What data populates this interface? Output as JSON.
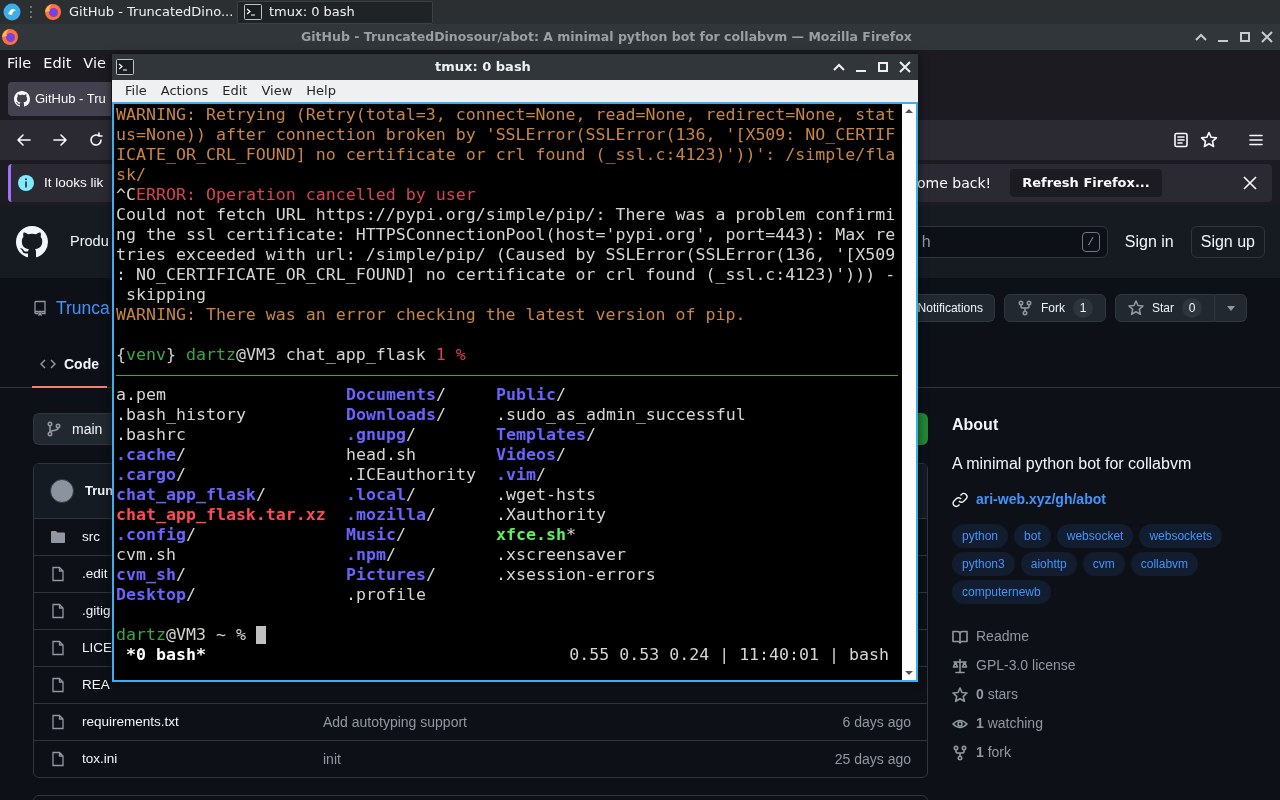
{
  "taskbar": {
    "tasks": [
      {
        "label": "GitHub - TruncatedDino...",
        "kind": "browser",
        "selected": false
      },
      {
        "label": "tmux: 0 bash",
        "kind": "terminal",
        "selected": true
      }
    ]
  },
  "browser": {
    "title": "GitHub - TruncatedDinosour/abot: A minimal python bot for collabvm — Mozilla Firefox",
    "menu": [
      "File",
      "Edit",
      "Vie"
    ],
    "tab": "GitHub - Tru",
    "notification": {
      "text_start": "It looks lik",
      "text_end": "ome back!",
      "button": "Refresh Firefox..."
    },
    "page": {
      "header": {
        "nav": "Produ",
        "search_placeholder": "h",
        "search_key": "/",
        "sign_in": "Sign in",
        "sign_up": "Sign up"
      },
      "repo": {
        "name": "Trunca",
        "actions": [
          {
            "kind": "notifications",
            "label": "Notifications"
          },
          {
            "kind": "fork",
            "label": "Fork",
            "count": "1"
          },
          {
            "kind": "star",
            "label": "Star",
            "count": "0"
          }
        ]
      },
      "tabs": [
        {
          "label": "Code",
          "selected": true
        }
      ],
      "branch": "main",
      "commit_author": "Trun",
      "files": [
        {
          "kind": "folder",
          "name": "src"
        },
        {
          "kind": "file",
          "name": ".edit"
        },
        {
          "kind": "file",
          "name": ".gitig"
        },
        {
          "kind": "file",
          "name": "LICE"
        },
        {
          "kind": "file",
          "name": "REA"
        },
        {
          "kind": "file",
          "name": "requirements.txt",
          "message": "Add autotyping support",
          "age": "6 days ago"
        },
        {
          "kind": "file",
          "name": "tox.ini",
          "message": "init",
          "age": "25 days ago"
        }
      ],
      "about": {
        "title": "About",
        "description": "A minimal python bot for collabvm",
        "link": "ari-web.xyz/gh/abot",
        "topics": [
          "python",
          "bot",
          "websocket",
          "websockets",
          "python3",
          "aiohttp",
          "cvm",
          "collabvm",
          "computernewb"
        ],
        "stats": [
          {
            "kind": "readme",
            "text": "Readme"
          },
          {
            "kind": "license",
            "text": "GPL-3.0 license"
          },
          {
            "kind": "stars",
            "text": "**0** stars"
          },
          {
            "kind": "watching",
            "text": "**1** watching"
          },
          {
            "kind": "forks",
            "text": "**1** fork"
          }
        ]
      }
    }
  },
  "terminal": {
    "title": "tmux: 0 bash",
    "menu": [
      "File",
      "Actions",
      "Edit",
      "View",
      "Help"
    ],
    "lines": [
      [
        {
          "kind": "warning",
          "text": "WARNING: Retrying (Retry(total=3, connect=None, read=None, redirect=None, stat"
        }
      ],
      [
        {
          "kind": "warning",
          "text": "us=None)) after connection broken by 'SSLError(SSLError(136, '[X509: NO_CERTIF"
        }
      ],
      [
        {
          "kind": "warning",
          "text": "ICATE_OR_CRL_FOUND] no certificate or crl found (_ssl.c:4123)'))': /simple/fla"
        }
      ],
      [
        {
          "kind": "warning",
          "text": "sk/"
        }
      ],
      [
        {
          "kind": "plain",
          "text": "^C"
        },
        {
          "kind": "error",
          "text": "ERROR: Operation cancelled by user"
        }
      ],
      [
        {
          "kind": "plain",
          "text": "Could not fetch URL https://pypi.org/simple/pip/: There was a problem confirmi"
        }
      ],
      [
        {
          "kind": "plain",
          "text": "ng the ssl certificate: HTTPSConnectionPool(host='pypi.org', port=443): Max re"
        }
      ],
      [
        {
          "kind": "plain",
          "text": "tries exceeded with url: /simple/pip/ (Caused by SSLError(SSLError(136, '[X509"
        }
      ],
      [
        {
          "kind": "plain",
          "text": ": NO_CERTIFICATE_OR_CRL_FOUND] no certificate or crl found (_ssl.c:4123)'))) -"
        }
      ],
      [
        {
          "kind": "plain",
          "text": " skipping"
        }
      ],
      [
        {
          "kind": "warning",
          "text": "WARNING: There was an error checking the latest version of pip."
        }
      ]
    ],
    "pane_prompt": [
      {
        "kind": "plain",
        "text": "{"
      },
      {
        "kind": "user",
        "text": "venv"
      },
      {
        "kind": "plain",
        "text": "} "
      },
      {
        "kind": "user",
        "text": "dartz"
      },
      {
        "kind": "plain",
        "text": "@VM3 chat_app_flask "
      },
      {
        "kind": "count",
        "text": "1 %"
      }
    ],
    "listing": [
      [
        {
          "kind": "file",
          "name": "a.pem"
        },
        {
          "kind": "file",
          "name": ".bash_history"
        },
        {
          "kind": "file",
          "name": ".bashrc"
        },
        {
          "kind": "dir",
          "name": ".cache",
          "suffix": "/"
        },
        {
          "kind": "dir",
          "name": ".cargo",
          "suffix": "/"
        },
        {
          "kind": "dir",
          "name": "chat_app_flask",
          "suffix": "/"
        },
        {
          "kind": "archive",
          "name": "chat_app_flask.tar.xz"
        },
        {
          "kind": "dir",
          "name": ".config",
          "suffix": "/"
        },
        {
          "kind": "file",
          "name": "cvm.sh"
        },
        {
          "kind": "dir",
          "name": "cvm_sh",
          "suffix": "/"
        },
        {
          "kind": "dir",
          "name": "Desktop",
          "suffix": "/"
        }
      ],
      [
        {
          "kind": "dir",
          "name": "Documents",
          "suffix": "/"
        },
        {
          "kind": "dir",
          "name": "Downloads",
          "suffix": "/"
        },
        {
          "kind": "dir",
          "name": ".gnupg",
          "suffix": "/"
        },
        {
          "kind": "file",
          "name": "head.sh"
        },
        {
          "kind": "file",
          "name": ".ICEauthority"
        },
        {
          "kind": "dir",
          "name": ".local",
          "suffix": "/"
        },
        {
          "kind": "dir",
          "name": ".mozilla",
          "suffix": "/"
        },
        {
          "kind": "dir",
          "name": "Music",
          "suffix": "/"
        },
        {
          "kind": "dir",
          "name": ".npm",
          "suffix": "/"
        },
        {
          "kind": "dir",
          "name": "Pictures",
          "suffix": "/"
        },
        {
          "kind": "file",
          "name": ".profile"
        }
      ],
      [
        {
          "kind": "dir",
          "name": "Public",
          "suffix": "/"
        },
        {
          "kind": "file",
          "name": ".sudo_as_admin_successful"
        },
        {
          "kind": "dir",
          "name": "Templates",
          "suffix": "/"
        },
        {
          "kind": "dir",
          "name": "Videos",
          "suffix": "/"
        },
        {
          "kind": "dir",
          "name": ".vim",
          "suffix": "/"
        },
        {
          "kind": "file",
          "name": ".wget-hsts"
        },
        {
          "kind": "file",
          "name": ".Xauthority"
        },
        {
          "kind": "exec",
          "name": "xfce.sh",
          "suffix": "*"
        },
        {
          "kind": "file",
          "name": ".xscreensaver"
        },
        {
          "kind": "file",
          "name": ".xsession-errors"
        }
      ]
    ],
    "prompt": [
      {
        "kind": "user",
        "text": "dartz"
      },
      {
        "kind": "plain",
        "text": "@VM3 ~ % "
      }
    ],
    "status": {
      "left": "*0 bash*",
      "right": "0.55 0.53 0.24 | 11:40:01 | bash"
    }
  }
}
